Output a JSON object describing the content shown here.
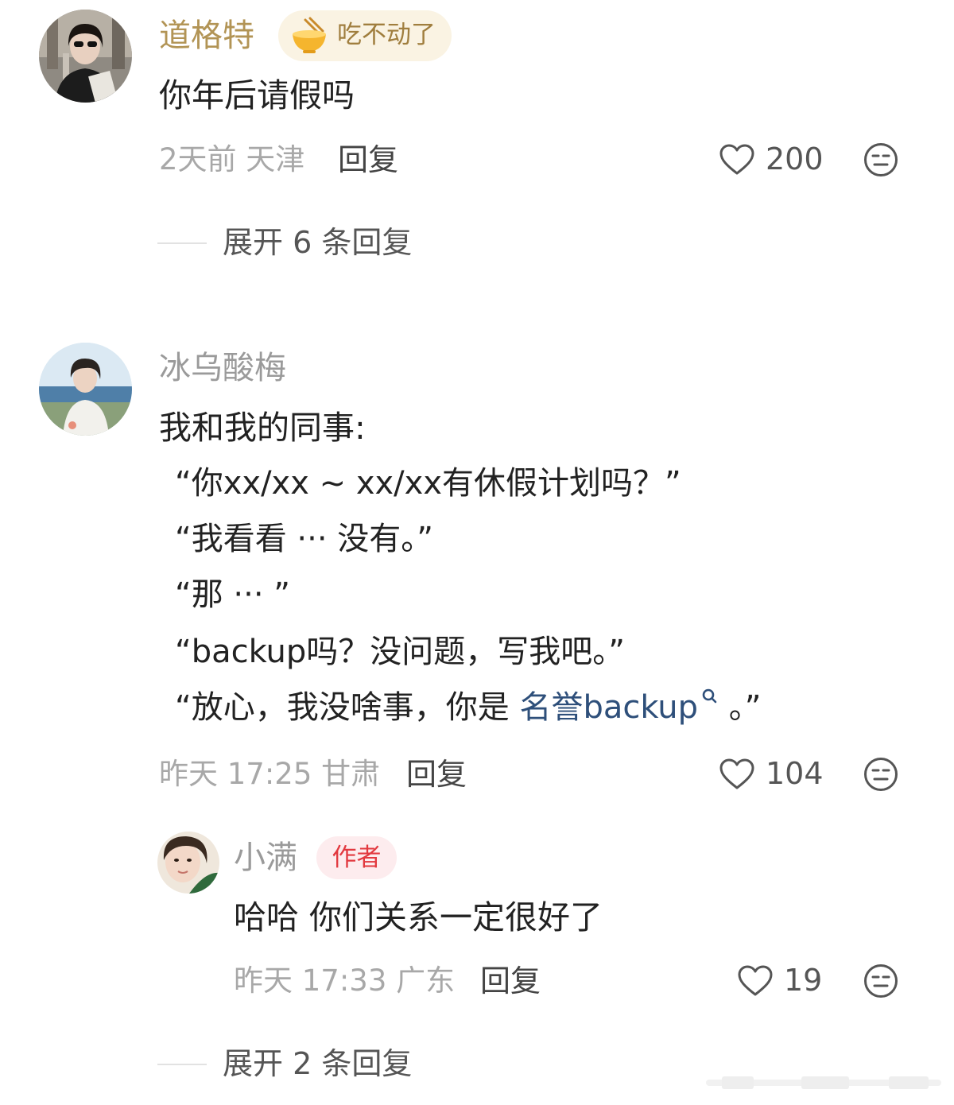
{
  "comments": [
    {
      "username": "道格特",
      "badge": "吃不动了",
      "badge_icon": "bowl-icon",
      "text": "你年后请假吗",
      "meta": "2天前 天津",
      "reply_label": "回复",
      "likes": "200",
      "expand": "展开 6 条回复"
    },
    {
      "username": "冰乌酸梅",
      "text_lines": [
        "我和我的同事:",
        "“你xx/xx ~ xx/xx有休假计划吗？”",
        "“我看看 ··· 没有。”",
        "“那 ··· ”",
        "“backup吗？没问题，写我吧。”"
      ],
      "last_line_prefix": "“放心，我没啥事，你是",
      "last_line_link": "名誉backup",
      "last_line_suffix": "。”",
      "meta": "昨天 17:25 甘肃",
      "reply_label": "回复",
      "likes": "104",
      "reply": {
        "username": "小满",
        "badge": "作者",
        "text": "哈哈 你们关系一定很好了",
        "meta": "昨天 17:33 广东",
        "reply_label": "回复",
        "likes": "19"
      },
      "expand": "展开 2 条回复"
    }
  ],
  "colors": {
    "gold_username": "#b29455",
    "gray_username": "#9a9a9a",
    "link": "#2e4f7a",
    "author_badge_text": "#e2393f",
    "author_badge_bg": "#fdecee",
    "food_badge_bg": "#faf3e3"
  }
}
